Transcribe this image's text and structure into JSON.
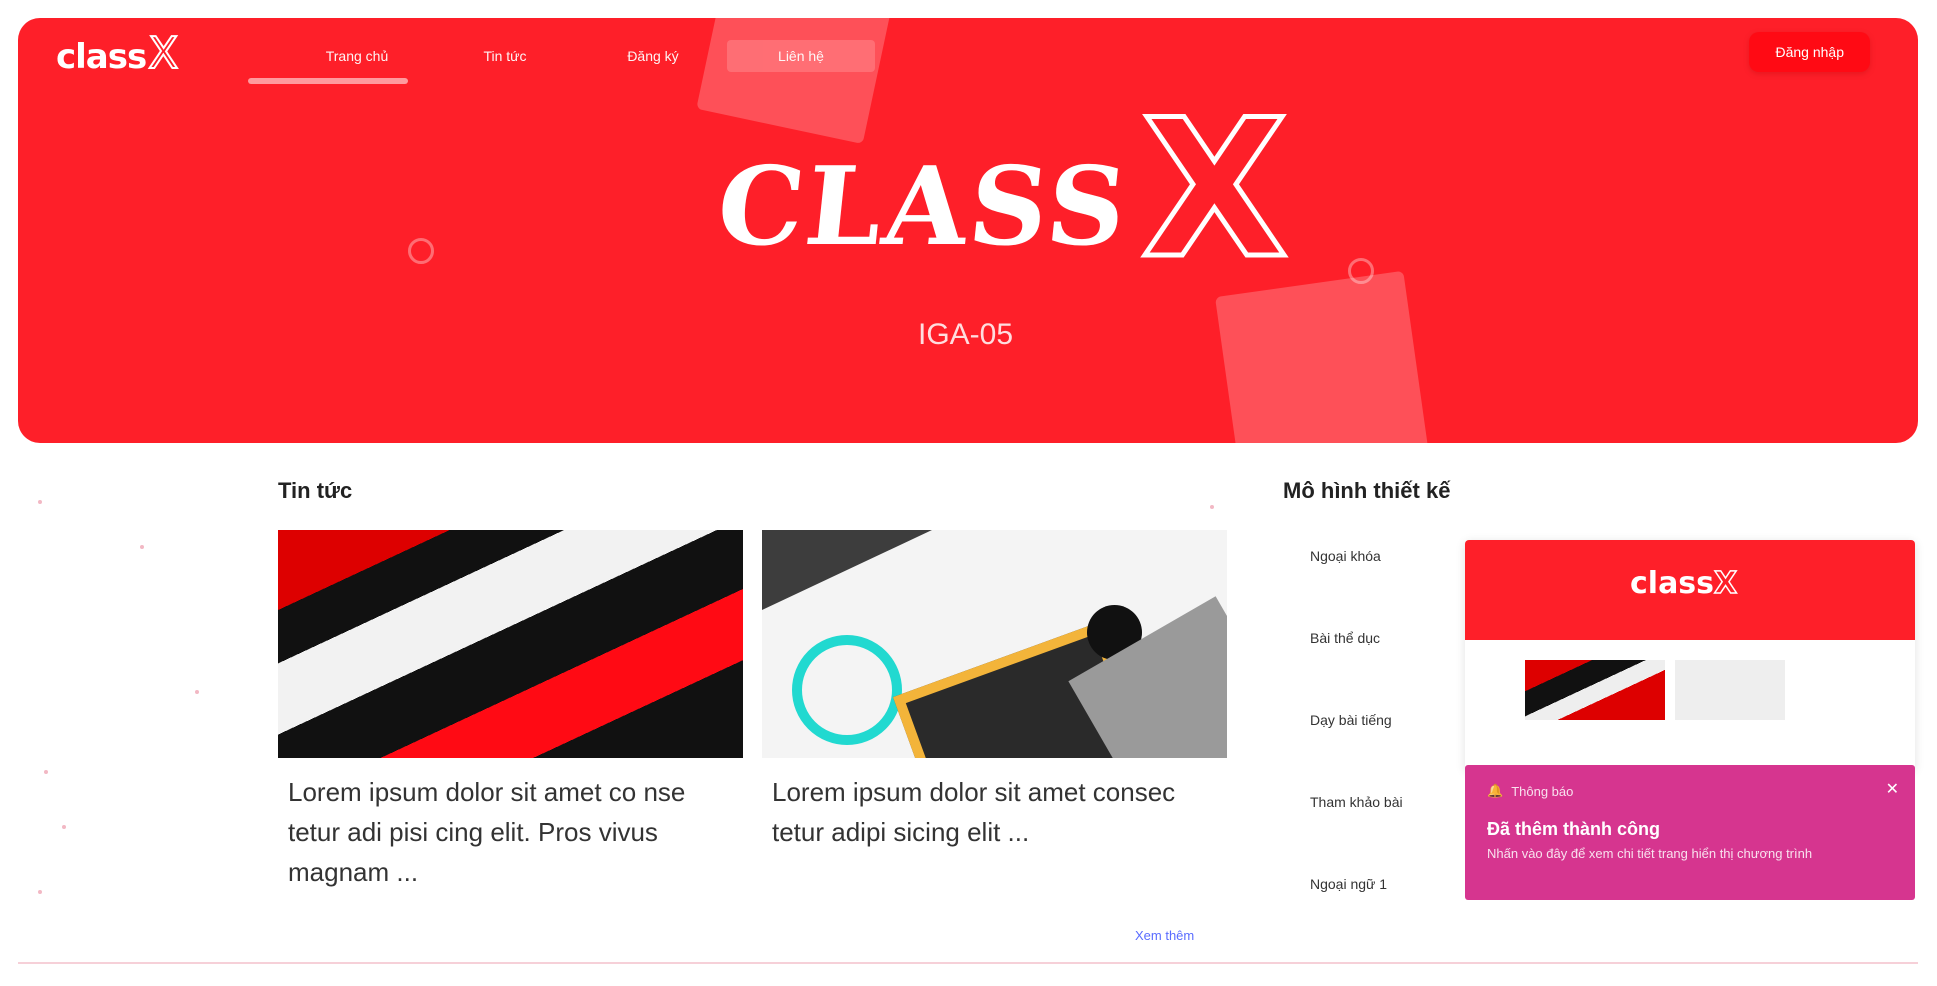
{
  "header": {
    "logo_text": "class",
    "logo_x": "X",
    "nav": [
      "Trang chủ",
      "Tin tức",
      "Đăng ký",
      "Liên hệ"
    ],
    "active_nav_index": 3,
    "login_label": "Đăng nhập"
  },
  "hero": {
    "title_part1": "CLASS",
    "title_part2": "X",
    "subtitle": "IGA-05"
  },
  "news": {
    "section_title": "Tin tức",
    "cards": [
      {
        "excerpt": "Lorem ipsum dolor sit amet co nse tetur adi pisi cing elit. Pros vivus magnam ..."
      },
      {
        "excerpt": "Lorem ipsum dolor sit amet consec tetur adipi sicing elit ..."
      }
    ],
    "view_all_label": "Xem thêm"
  },
  "side": {
    "section_title": "Mô hình thiết kế",
    "items": [
      "Ngoại khóa",
      "Bài thể dục",
      "Dạy bài tiếng",
      "Tham khảo bài",
      "Ngoại ngữ 1"
    ]
  },
  "toast": {
    "header": "Thông báo",
    "title": "Đã thêm thành công",
    "body": "Nhấn vào đây để xem chi tiết trang hiển thị chương trình",
    "bg_color": "#d6358f"
  },
  "colors": {
    "brand": "#fe1f29"
  }
}
